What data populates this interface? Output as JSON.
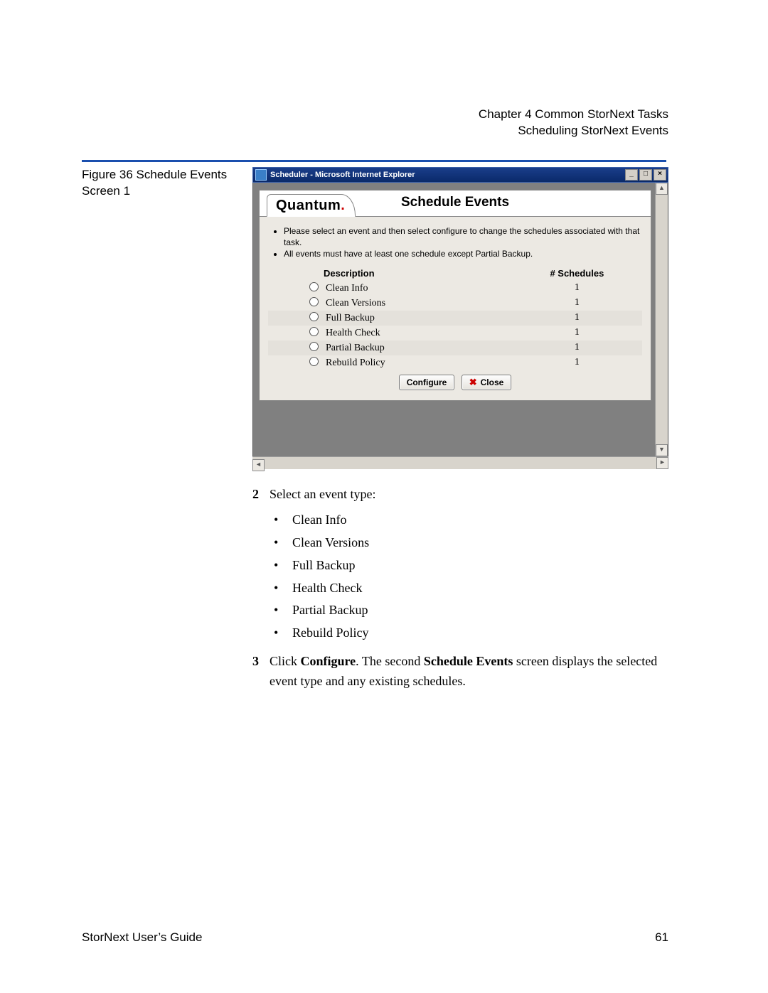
{
  "header": {
    "line1": "Chapter 4  Common StorNext Tasks",
    "line2": "Scheduling StorNext Events"
  },
  "figure_caption": "Figure 36  Schedule Events Screen 1",
  "window": {
    "title": "Scheduler - Microsoft Internet Explorer",
    "min": "_",
    "max": "□",
    "close": "×"
  },
  "panel": {
    "brand": "Quantum",
    "brand_dot": ".",
    "heading": "Schedule Events",
    "instructions": [
      "Please select an event and then select configure to change the schedules associated with that task.",
      "All events must have at least one schedule except Partial Backup."
    ],
    "col_desc": "Description",
    "col_num": "# Schedules",
    "rows": [
      {
        "label": "Clean Info",
        "count": "1"
      },
      {
        "label": "Clean Versions",
        "count": "1"
      },
      {
        "label": "Full Backup",
        "count": "1"
      },
      {
        "label": "Health Check",
        "count": "1"
      },
      {
        "label": "Partial Backup",
        "count": "1"
      },
      {
        "label": "Rebuild Policy",
        "count": "1"
      }
    ],
    "btn_configure": "Configure",
    "btn_close": "Close"
  },
  "steps": {
    "s2_num": "2",
    "s2_text": "Select an event type:",
    "types": [
      "Clean Info",
      "Clean Versions",
      "Full Backup",
      "Health Check",
      "Partial Backup",
      "Rebuild Policy"
    ],
    "s3_num": "3",
    "s3_pre": "Click ",
    "s3_bold1": "Configure",
    "s3_mid": ". The second ",
    "s3_bold2": "Schedule Events",
    "s3_post": " screen displays the selected event type and any existing schedules."
  },
  "footer": {
    "left": "StorNext User’s Guide",
    "right": "61"
  }
}
